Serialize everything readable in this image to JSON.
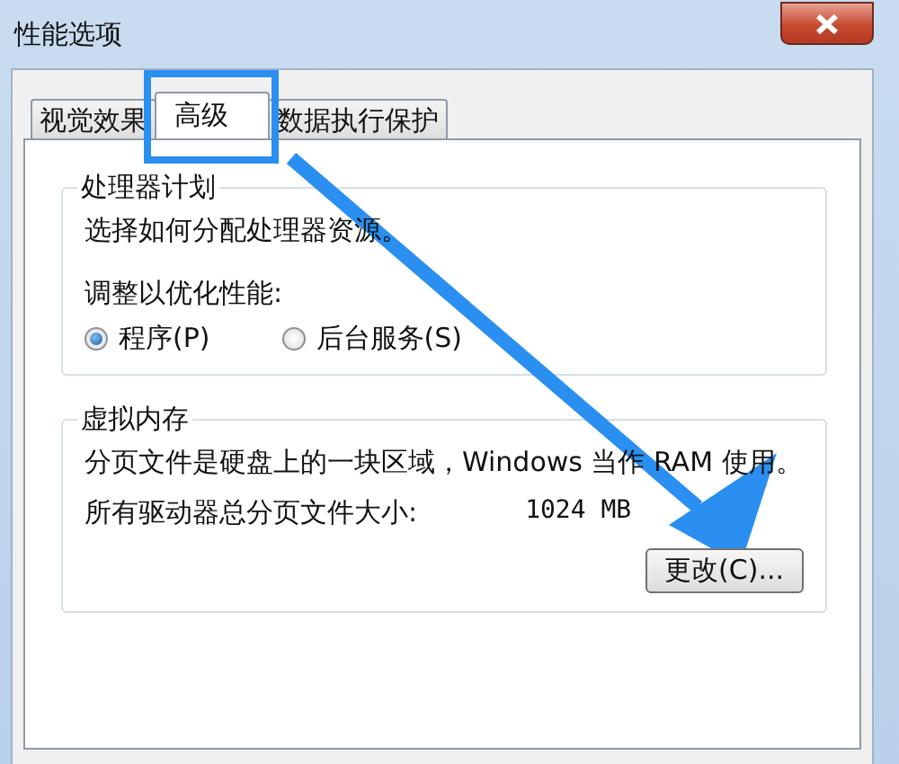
{
  "window": {
    "title": "性能选项"
  },
  "tabs": [
    {
      "label": "视觉效果",
      "selected": false,
      "highlighted": false
    },
    {
      "label": "高级",
      "selected": true,
      "highlighted": true
    },
    {
      "label": "数据执行保护",
      "selected": false,
      "highlighted": false
    }
  ],
  "processor_scheduling": {
    "title": "处理器计划",
    "description": "选择如何分配处理器资源。",
    "prompt": "调整以优化性能:",
    "options": [
      {
        "label": "程序(P)",
        "selected": true
      },
      {
        "label": "后台服务(S)",
        "selected": false
      }
    ]
  },
  "virtual_memory": {
    "title": "虚拟内存",
    "description": "分页文件是硬盘上的一块区域，Windows 当作 RAM 使用。",
    "total_label": "所有驱动器总分页文件大小:",
    "total_value": "1024 MB",
    "button": "更改(C)..."
  }
}
